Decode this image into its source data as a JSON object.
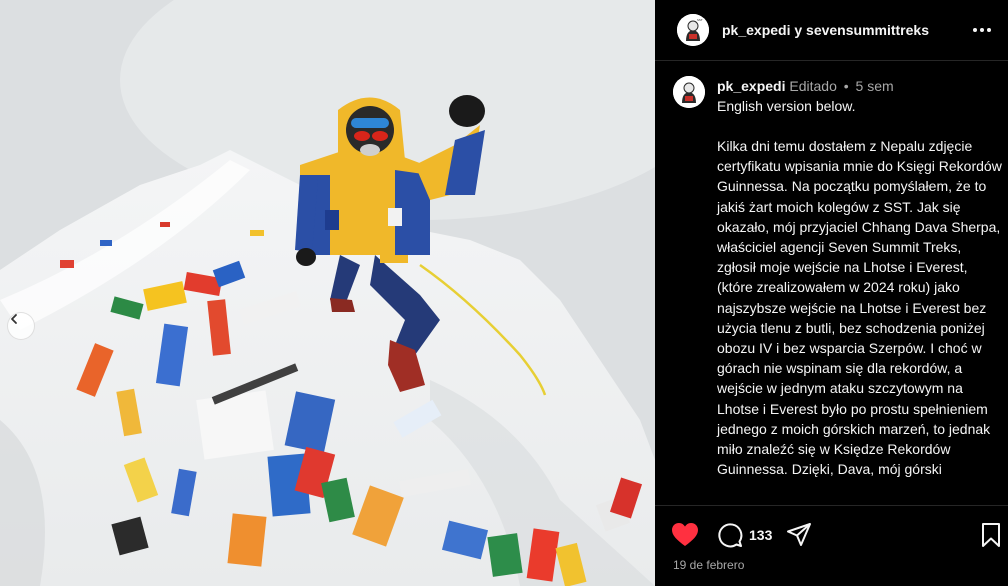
{
  "photo": {
    "alt": "Climber on summit ridge with prayer flags",
    "prev_icon": "chevron-left-icon"
  },
  "header": {
    "title": "pk_expedi y sevensummittreks",
    "avatar_icon": "profile-avatar",
    "more_icon": "more-horizontal-icon"
  },
  "comment": {
    "username": "pk_expedi",
    "edited": "Editado",
    "separator": "•",
    "time": "5 sem",
    "first_line": "English version below.",
    "body": "Kilka dni temu dostałem z Nepalu zdjęcie certyfikatu wpisania mnie do Księgi Rekordów Guinnessa. Na początku pomyślałem, że to jakiś żart moich kolegów z SST. Jak się okazało, mój przyjaciel Chhang Dava Sherpa, właściciel agencji Seven Summit Treks, zgłosił moje wejście na Lhotse i Everest, (które zrealizowałem w 2024 roku) jako najszybsze wejście na Lhotse i Everest bez użycia tlenu z butli, bez schodzenia poniżej obozu IV i bez wsparcia Szerpów. I choć w górach nie wspinam się dla rekordów, a wejście w jednym ataku szczytowym na Lhotse i Everest było po prostu spełnieniem jednego z moich górskich marzeń, to jednak miło znaleźć się w Księdze Rekordów Guinnessa. Dzięki, Dava, mój górski"
  },
  "actions": {
    "like_icon": "heart-icon",
    "like_color": "#ff3040",
    "comment_icon": "comment-icon",
    "comment_count": "133",
    "share_icon": "share-icon",
    "save_icon": "bookmark-icon"
  },
  "post_date": "19 de febrero"
}
